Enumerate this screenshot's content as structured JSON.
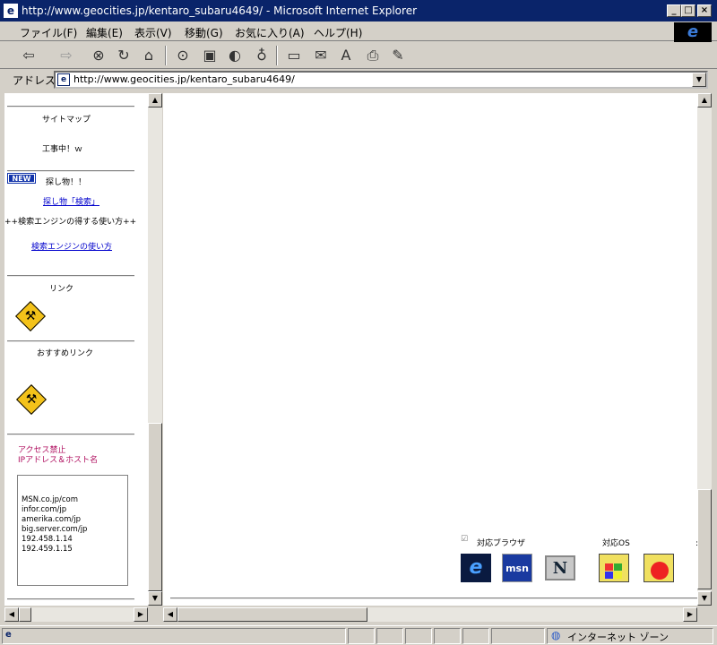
{
  "window": {
    "title": "http://www.geocities.jp/kentaro_subaru4649/ - Microsoft Internet Explorer",
    "minimize": "_",
    "maximize": "□",
    "close": "×"
  },
  "menu": [
    "ファイル(F)",
    "編集(E)",
    "表示(V)",
    "移動(G)",
    "お気に入り(A)",
    "ヘルプ(H)"
  ],
  "address": {
    "label": "アドレス",
    "url": "http://www.geocities.jp/kentaro_subaru4649/"
  },
  "left": {
    "sitemap": "サイトマップ",
    "construction": "工事中！ｗ",
    "new_badge": "NEW",
    "search_heading": "探し物！！",
    "search_link": "探し物「検索」",
    "engine_heading": "++検索エンジンの得する使い方++",
    "engine_link": "検索エンジンの使い方",
    "links_heading": "リンク",
    "recommend_heading": "おすすめリンク",
    "access_ban": "アクセス禁止",
    "ip_host": "IPアドレス＆ホスト名",
    "blocked": [
      "MSN.co.jp/com",
      "infor.com/jp",
      "amerika.com/jp",
      "big.server.com/jp",
      "192.458.1.14",
      "192.459.1.15"
    ]
  },
  "right": {
    "browser_label": "対応ブラウザ",
    "os_label": "対応OS",
    "msn_text": "msn",
    "netscape_text": "N",
    "ie_text": "e"
  },
  "status": {
    "zone": "インターネット ゾーン"
  }
}
